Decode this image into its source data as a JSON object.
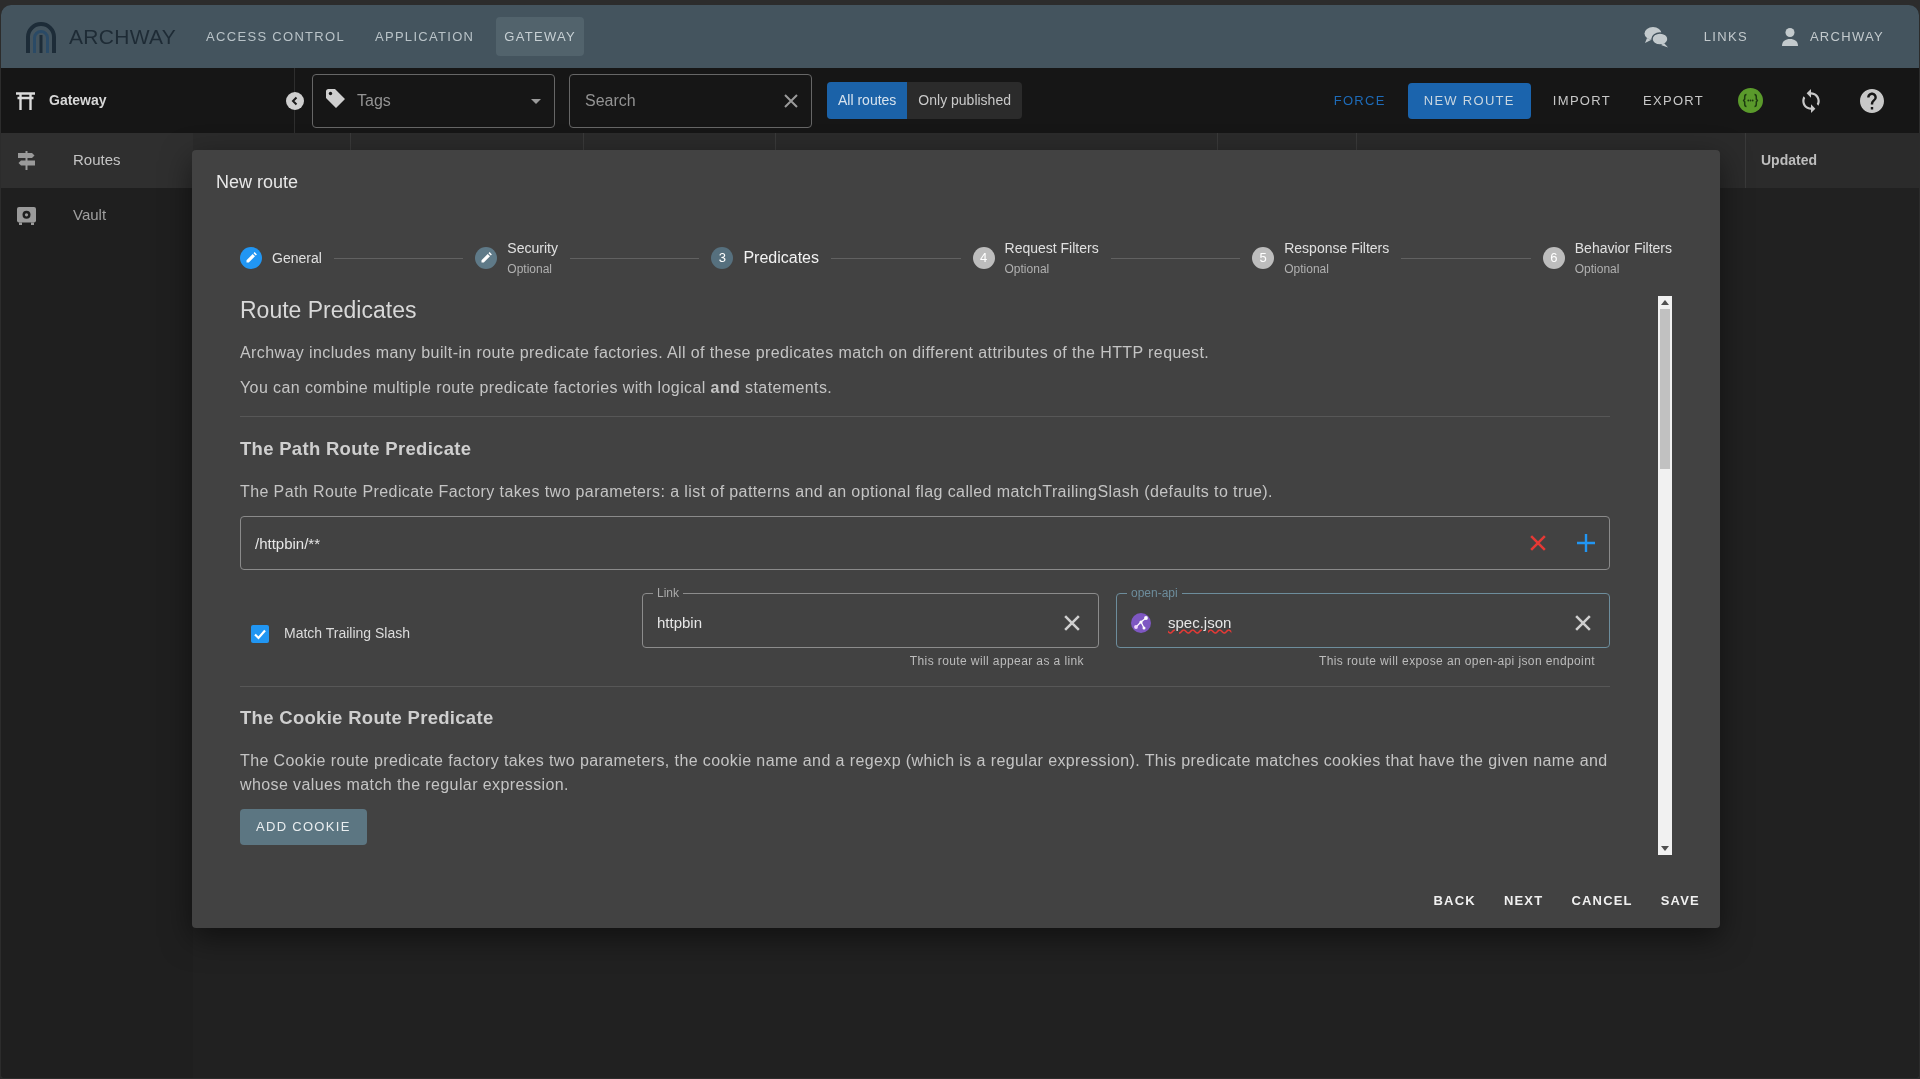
{
  "top_nav": {
    "brand": "ARCHWAY",
    "items": [
      {
        "label": "ACCESS CONTROL",
        "selected": false
      },
      {
        "label": "APPLICATION",
        "selected": false
      },
      {
        "label": "GATEWAY",
        "selected": true
      }
    ],
    "links": "LINKS",
    "user": "ARCHWAY"
  },
  "toolbar": {
    "section": "Gateway",
    "tags": {
      "placeholder": "Tags"
    },
    "search": {
      "placeholder": "Search"
    },
    "filters": [
      {
        "label": "All routes",
        "selected": true
      },
      {
        "label": "Only published",
        "selected": false
      }
    ],
    "actions": [
      {
        "label": "FORCE",
        "kind": "text-primary"
      },
      {
        "label": "NEW ROUTE",
        "kind": "primary"
      },
      {
        "label": "IMPORT",
        "kind": "text"
      },
      {
        "label": "EXPORT",
        "kind": "text"
      }
    ]
  },
  "sidebar": {
    "items": [
      {
        "label": "Routes",
        "selected": true
      },
      {
        "label": "Vault",
        "selected": false
      }
    ]
  },
  "table": {
    "columns": [
      {
        "label": "Updated"
      }
    ]
  },
  "dialog": {
    "title": "New route",
    "steps": [
      {
        "label": "General",
        "selected": false,
        "complete": true,
        "editable": true
      },
      {
        "label": "Security",
        "subtitle": "Optional",
        "selected": false,
        "complete": false,
        "editable": true
      },
      {
        "label": "Predicates",
        "number": "3",
        "selected": true,
        "complete": false,
        "editable": false
      },
      {
        "label": "Request Filters",
        "subtitle": "Optional",
        "number": "4",
        "selected": false,
        "complete": false,
        "editable": false
      },
      {
        "label": "Response Filters",
        "subtitle": "Optional",
        "number": "5",
        "selected": false,
        "complete": false,
        "editable": false
      },
      {
        "label": "Behavior Filters",
        "subtitle": "Optional",
        "number": "6",
        "selected": false,
        "complete": false,
        "editable": false
      }
    ],
    "content": {
      "title": "Route Predicates",
      "intro": [
        "Archway includes many built-in route predicate factories. All of these predicates match on different attributes of the HTTP request.",
        "You can combine multiple route predicate factories with logical **and** statements."
      ],
      "path_predicate": {
        "heading": "The Path Route Predicate",
        "description": "The Path Route Predicate Factory takes two parameters: a list of patterns and an optional flag called matchTrailingSlash (defaults to true).",
        "patterns": [
          {
            "value": "/httpbin/**"
          }
        ],
        "match_trailing_slash": {
          "label": "Match Trailing Slash",
          "checked": true
        },
        "link": {
          "label": "Link",
          "value": "httpbin",
          "hint": "This route will appear as a link",
          "focused": false
        },
        "open_api": {
          "label": "open-api",
          "value": "spec.json",
          "hint": "This route will expose an open-api json endpoint",
          "focused": true,
          "spellcheck_error": true
        }
      },
      "cookie_predicate": {
        "heading": "The Cookie Route Predicate",
        "description": "The Cookie route predicate factory takes two parameters, the cookie name and a regexp (which is a regular expression). This predicate matches cookies that have the given name and whose values match the regular expression.",
        "button": "ADD COOKIE"
      }
    },
    "buttons": [
      "BACK",
      "NEXT",
      "CANCEL",
      "SAVE"
    ]
  }
}
